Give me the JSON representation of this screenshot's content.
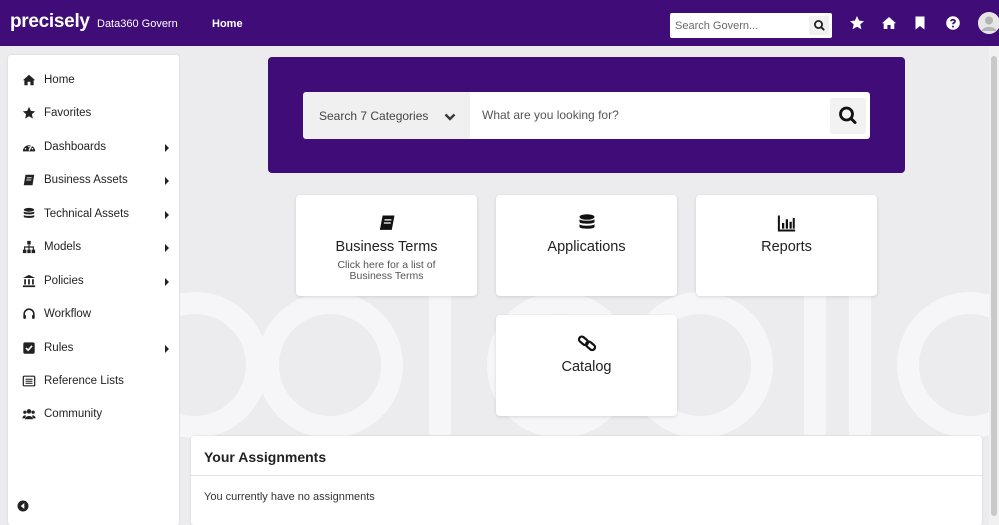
{
  "header": {
    "brand": "precisely",
    "product": "Data360 Govern",
    "nav_home": "Home",
    "search_placeholder": "Search Govern..."
  },
  "sidebar": {
    "items": [
      {
        "label": "Home",
        "icon": "home-icon",
        "has_submenu": false
      },
      {
        "label": "Favorites",
        "icon": "star-icon",
        "has_submenu": false
      },
      {
        "label": "Dashboards",
        "icon": "tachometer-icon",
        "has_submenu": true
      },
      {
        "label": "Business Assets",
        "icon": "book-icon",
        "has_submenu": true
      },
      {
        "label": "Technical Assets",
        "icon": "database-icon",
        "has_submenu": true
      },
      {
        "label": "Models",
        "icon": "sitemap-icon",
        "has_submenu": true
      },
      {
        "label": "Policies",
        "icon": "institution-icon",
        "has_submenu": true
      },
      {
        "label": "Workflow",
        "icon": "headset-icon",
        "has_submenu": false
      },
      {
        "label": "Rules",
        "icon": "check-square-icon",
        "has_submenu": true
      },
      {
        "label": "Reference Lists",
        "icon": "list-alt-icon",
        "has_submenu": false
      },
      {
        "label": "Community",
        "icon": "users-icon",
        "has_submenu": false
      }
    ]
  },
  "search": {
    "category_label": "Search 7 Categories",
    "placeholder": "What are you looking for?"
  },
  "cards": [
    {
      "title": "Business Terms",
      "subtitle": "Click here for a list of Business Terms",
      "icon": "book-icon"
    },
    {
      "title": "Applications",
      "subtitle": "",
      "icon": "database-icon"
    },
    {
      "title": "Reports",
      "subtitle": "",
      "icon": "bar-chart-icon"
    },
    {
      "title": "Catalog",
      "subtitle": "",
      "icon": "link-icon"
    }
  ],
  "assignments": {
    "title": "Your Assignments",
    "empty_message": "You currently have no assignments"
  },
  "colors": {
    "brand_purple": "#3f0c78",
    "background": "#ecebee"
  }
}
